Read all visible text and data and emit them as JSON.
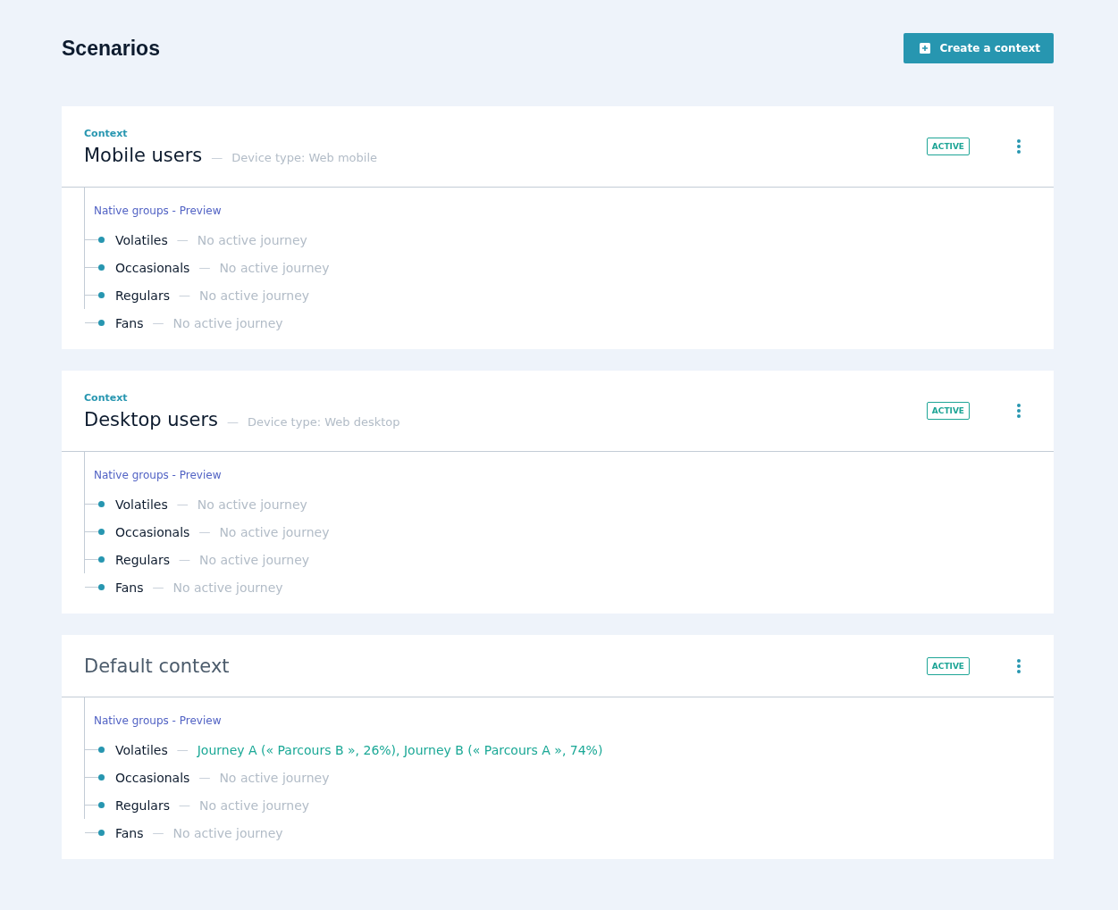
{
  "page": {
    "title": "Scenarios",
    "create_button": "Create a context"
  },
  "contexts": [
    {
      "kind": "custom",
      "label": "Context",
      "title": "Mobile users",
      "separator": "—",
      "subtitle": "Device type: Web mobile",
      "badge": "ACTIVE",
      "groups_heading": "Native groups - Preview",
      "groups": [
        {
          "name": "Volatiles",
          "separator": "—",
          "journey": "No active journey",
          "active": false
        },
        {
          "name": "Occasionals",
          "separator": "—",
          "journey": "No active journey",
          "active": false
        },
        {
          "name": "Regulars",
          "separator": "—",
          "journey": "No active journey",
          "active": false
        },
        {
          "name": "Fans",
          "separator": "—",
          "journey": "No active journey",
          "active": false
        }
      ]
    },
    {
      "kind": "custom",
      "label": "Context",
      "title": "Desktop users",
      "separator": "—",
      "subtitle": "Device type: Web desktop",
      "badge": "ACTIVE",
      "groups_heading": "Native groups - Preview",
      "groups": [
        {
          "name": "Volatiles",
          "separator": "—",
          "journey": "No active journey",
          "active": false
        },
        {
          "name": "Occasionals",
          "separator": "—",
          "journey": "No active journey",
          "active": false
        },
        {
          "name": "Regulars",
          "separator": "—",
          "journey": "No active journey",
          "active": false
        },
        {
          "name": "Fans",
          "separator": "—",
          "journey": "No active journey",
          "active": false
        }
      ]
    },
    {
      "kind": "default",
      "title": "Default context",
      "badge": "ACTIVE",
      "groups_heading": "Native groups - Preview",
      "groups": [
        {
          "name": "Volatiles",
          "separator": "—",
          "journey": "Journey A (« Parcours B », 26%), Journey B (« Parcours A », 74%)",
          "active": true
        },
        {
          "name": "Occasionals",
          "separator": "—",
          "journey": "No active journey",
          "active": false
        },
        {
          "name": "Regulars",
          "separator": "—",
          "journey": "No active journey",
          "active": false
        },
        {
          "name": "Fans",
          "separator": "—",
          "journey": "No active journey",
          "active": false
        }
      ]
    }
  ]
}
